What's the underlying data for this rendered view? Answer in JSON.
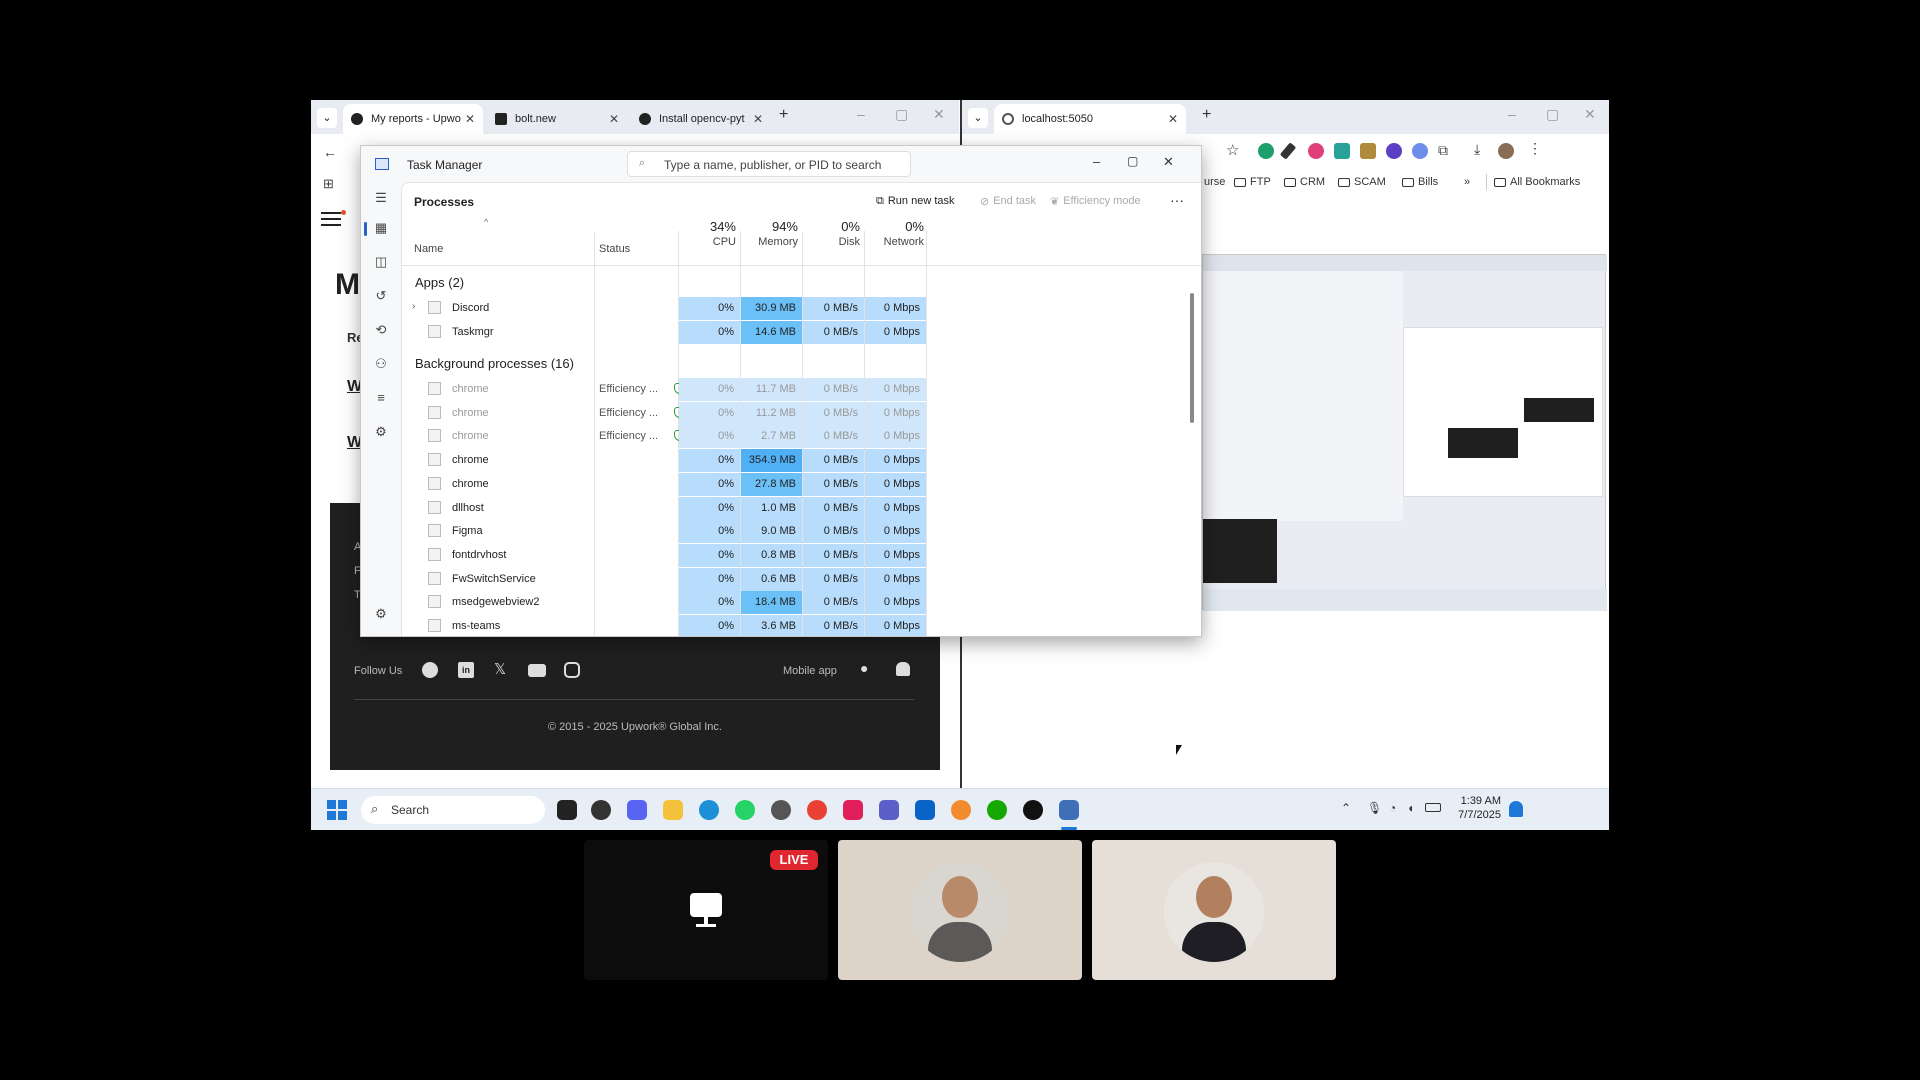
{
  "left_browser": {
    "tabs": [
      {
        "label": "My reports - Upwo",
        "active": true
      },
      {
        "label": "bolt.new",
        "active": false
      },
      {
        "label": "Install opencv-pyt",
        "active": false
      }
    ],
    "page": {
      "heading_letter": "M",
      "line1": "Re",
      "link1": "W",
      "link2": "W",
      "footer_lines": [
        "A",
        "F",
        "T"
      ],
      "follow_us": "Follow Us",
      "mobile_app": "Mobile app",
      "copyright": "© 2015 - 2025 Upwork® Global Inc."
    }
  },
  "right_browser": {
    "tab_label": "localhost:5050",
    "bookmarks": [
      {
        "label": "urse",
        "folder": false
      },
      {
        "label": "FTP",
        "folder": true
      },
      {
        "label": "CRM",
        "folder": true
      },
      {
        "label": "SCAM",
        "folder": true
      },
      {
        "label": "Bills",
        "folder": true
      }
    ],
    "more_chevron": "»",
    "all_bookmarks": "All Bookmarks"
  },
  "task_manager": {
    "title": "Task Manager",
    "search_placeholder": "Type a name, publisher, or PID to search",
    "section": "Processes",
    "actions": {
      "run_new_task": "Run new task",
      "end_task": "End task",
      "efficiency_mode": "Efficiency mode",
      "more": "···"
    },
    "columns": {
      "name": "Name",
      "status": "Status",
      "cpu_pct": "34%",
      "cpu": "CPU",
      "mem_pct": "94%",
      "mem": "Memory",
      "disk_pct": "0%",
      "disk": "Disk",
      "net_pct": "0%",
      "net": "Network"
    },
    "apps_header": "Apps (2)",
    "apps": [
      {
        "name": "Discord",
        "status": "",
        "cpu": "0%",
        "mem": "30.9 MB",
        "disk": "0 MB/s",
        "net": "0 Mbps",
        "expand": true
      },
      {
        "name": "Taskmgr",
        "status": "",
        "cpu": "0%",
        "mem": "14.6 MB",
        "disk": "0 MB/s",
        "net": "0 Mbps",
        "expand": false
      }
    ],
    "bg_header": "Background processes (16)",
    "background": [
      {
        "name": "chrome",
        "status": "Efficiency ...",
        "cpu": "0%",
        "mem": "11.7 MB",
        "disk": "0 MB/s",
        "net": "0 Mbps",
        "dim": true
      },
      {
        "name": "chrome",
        "status": "Efficiency ...",
        "cpu": "0%",
        "mem": "11.2 MB",
        "disk": "0 MB/s",
        "net": "0 Mbps",
        "dim": true
      },
      {
        "name": "chrome",
        "status": "Efficiency ...",
        "cpu": "0%",
        "mem": "2.7 MB",
        "disk": "0 MB/s",
        "net": "0 Mbps",
        "dim": true
      },
      {
        "name": "chrome",
        "status": "",
        "cpu": "0%",
        "mem": "354.9 MB",
        "disk": "0 MB/s",
        "net": "0 Mbps",
        "dim": false
      },
      {
        "name": "chrome",
        "status": "",
        "cpu": "0%",
        "mem": "27.8 MB",
        "disk": "0 MB/s",
        "net": "0 Mbps",
        "dim": false
      },
      {
        "name": "dllhost",
        "status": "",
        "cpu": "0%",
        "mem": "1.0 MB",
        "disk": "0 MB/s",
        "net": "0 Mbps",
        "dim": false
      },
      {
        "name": "Figma",
        "status": "",
        "cpu": "0%",
        "mem": "9.0 MB",
        "disk": "0 MB/s",
        "net": "0 Mbps",
        "dim": false
      },
      {
        "name": "fontdrvhost",
        "status": "",
        "cpu": "0%",
        "mem": "0.8 MB",
        "disk": "0 MB/s",
        "net": "0 Mbps",
        "dim": false
      },
      {
        "name": "FwSwitchService",
        "status": "",
        "cpu": "0%",
        "mem": "0.6 MB",
        "disk": "0 MB/s",
        "net": "0 Mbps",
        "dim": false
      },
      {
        "name": "msedgewebview2",
        "status": "",
        "cpu": "0%",
        "mem": "18.4 MB",
        "disk": "0 MB/s",
        "net": "0 Mbps",
        "dim": false
      },
      {
        "name": "ms-teams",
        "status": "",
        "cpu": "0%",
        "mem": "3.6 MB",
        "disk": "0 MB/s",
        "net": "0 Mbps",
        "dim": false
      }
    ]
  },
  "taskbar": {
    "search_placeholder": "Search",
    "time": "1:39 AM",
    "date": "7/7/2025"
  },
  "participants": {
    "live_badge": "LIVE"
  }
}
